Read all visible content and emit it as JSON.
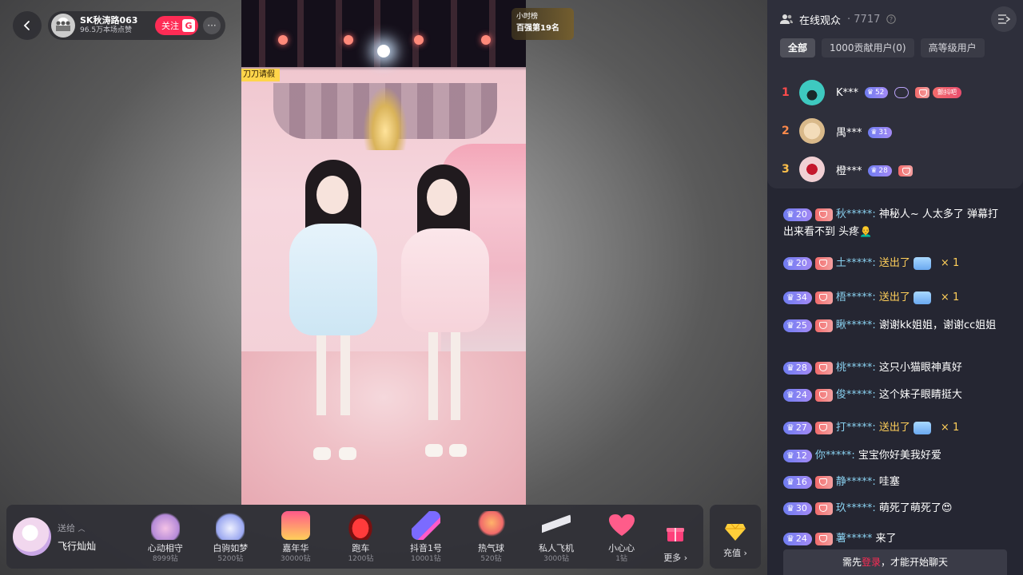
{
  "host": {
    "name": "SK秋涛路063",
    "likes": "96.5万本场点赞",
    "follow_label": "关注",
    "follow_badge": "G",
    "more": "···"
  },
  "rank_badge": {
    "line1": "小时榜",
    "line2": "百强第19名"
  },
  "video": {
    "tag": "刀刀请假"
  },
  "gift_bar": {
    "send_label": "送给",
    "send_target": "飞行灿灿",
    "gifts": [
      {
        "name": "心动相守",
        "price": "8999钻"
      },
      {
        "name": "白驹如梦",
        "price": "5200钻"
      },
      {
        "name": "嘉年华",
        "price": "30000钻"
      },
      {
        "name": "跑车",
        "price": "1200钻"
      },
      {
        "name": "抖音1号",
        "price": "10001钻"
      },
      {
        "name": "热气球",
        "price": "520钻"
      },
      {
        "name": "私人飞机",
        "price": "3000钻"
      },
      {
        "name": "小心心",
        "price": "1钻"
      }
    ],
    "more_label": "更多",
    "recharge_label": "充值"
  },
  "audience": {
    "title": "在线观众",
    "count": "· 7717",
    "tabs": [
      "全部",
      "1000贡献用户(0)",
      "高等级用户"
    ],
    "rows": [
      {
        "rank": "1",
        "name": "K***",
        "level": "52",
        "fan_tag": "颤抖吧"
      },
      {
        "rank": "2",
        "name": "禺***",
        "level": "31"
      },
      {
        "rank": "3",
        "name": "橙***",
        "level": "28"
      }
    ]
  },
  "chat": {
    "messages": [
      {
        "level": "20",
        "user": "秋*****:",
        "text": " 神秘人~ 人太多了 弹幕打出来看不到 头疼👨‍🦲"
      },
      {
        "level": "20",
        "user": "土*****:",
        "gift": "送出了",
        "times": "× 1"
      },
      {
        "level": "34",
        "user": "梧*****:",
        "gift": "送出了",
        "times": "× 1"
      },
      {
        "level": "25",
        "user": "瞅*****:",
        "text": " 谢谢kk姐姐，谢谢cc姐姐"
      },
      {
        "level": "28",
        "user": "桃*****:",
        "text": " 这只小猫眼神真好"
      },
      {
        "level": "24",
        "user": "俊*****:",
        "text": " 这个妹子眼睛挺大"
      },
      {
        "level": "27",
        "user": "打*****:",
        "gift": "送出了",
        "times": "× 1"
      },
      {
        "level": "12",
        "user": "你*****:",
        "text": " 宝宝你好美我好爱"
      },
      {
        "level": "16",
        "user": "静*****:",
        "text": " 哇塞"
      },
      {
        "level": "30",
        "user": "玖*****:",
        "text": " 萌死了萌死了😍"
      },
      {
        "level": "24",
        "user": "薯*****",
        "text": " 来了"
      }
    ],
    "login_prefix": "需先",
    "login_link": "登录",
    "login_suffix": "，才能开始聊天"
  }
}
